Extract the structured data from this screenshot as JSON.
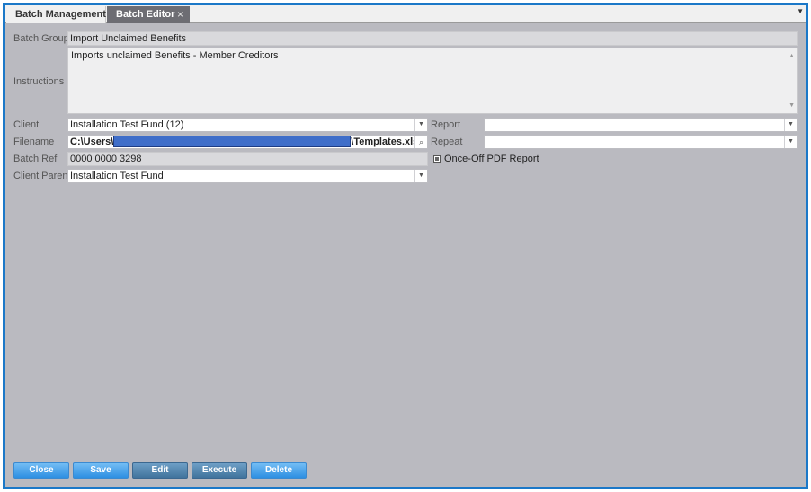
{
  "tabs": [
    {
      "label": "Batch Management"
    },
    {
      "label": "Batch Editor",
      "close": "×"
    }
  ],
  "form": {
    "batch_group": {
      "label": "Batch Group",
      "value": "Import Unclaimed Benefits"
    },
    "instructions": {
      "label": "Instructions",
      "value": "Imports unclaimed Benefits - Member Creditors"
    },
    "client": {
      "label": "Client",
      "value": "Installation Test Fund (12)"
    },
    "filename": {
      "label": "Filename",
      "prefix": "C:\\Users\\",
      "suffix": "\\Templates.xlsx"
    },
    "batch_ref": {
      "label": "Batch Ref",
      "value": "0000 0000 3298"
    },
    "client_parent": {
      "label": "Client Parent",
      "value": "Installation Test Fund"
    },
    "report": {
      "label": "Report",
      "value": ""
    },
    "repeat": {
      "label": "Repeat",
      "value": ""
    },
    "once_off_pdf": {
      "label": "Once-Off PDF Report",
      "checked": true
    }
  },
  "buttons": {
    "close": "Close",
    "save": "Save",
    "edit": "Edit",
    "execute": "Execute",
    "delete": "Delete"
  },
  "colors": {
    "frame": "#1b78c8",
    "panel": "#babac0",
    "button": "#2d8fe2",
    "redaction": "#3f6ec9"
  }
}
